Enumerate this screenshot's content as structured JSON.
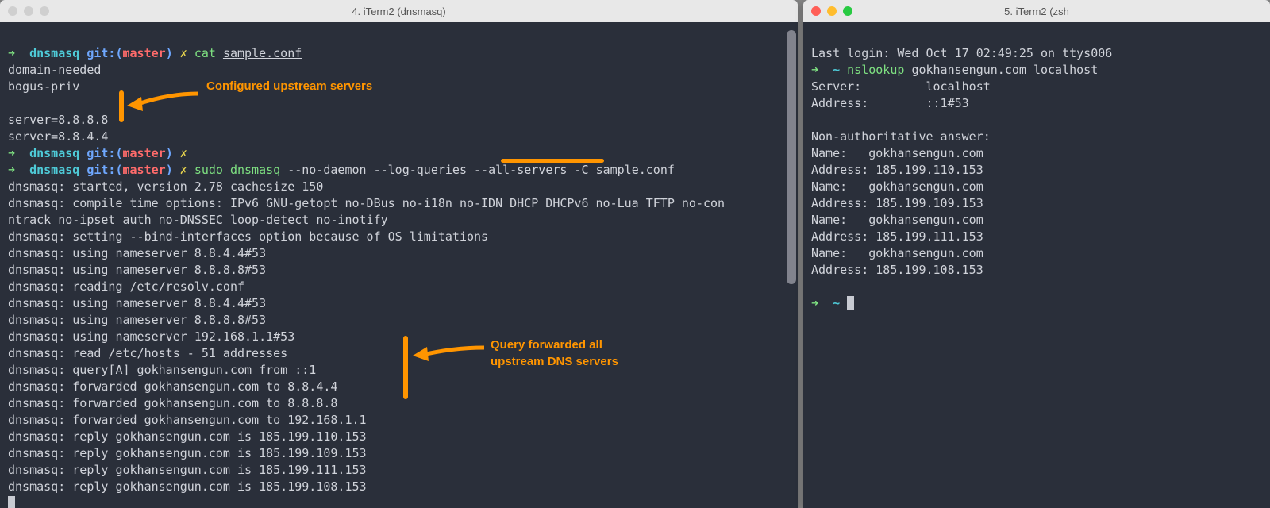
{
  "left": {
    "title": "4. iTerm2 (dnsmasq)",
    "traffic_active": false,
    "prompt": {
      "arrow": "➜",
      "dir": "dnsmasq",
      "git_label": "git:(",
      "branch": "master",
      "git_close": ")",
      "dirty": "✗"
    },
    "cmd1": "cat",
    "cmd1_arg": "sample.conf",
    "conf_lines": [
      "domain-needed",
      "bogus-priv",
      "",
      "server=8.8.8.8",
      "server=8.8.4.4"
    ],
    "cmd2_sudo": "sudo",
    "cmd2_prog": "dnsmasq",
    "cmd2_args_a": "--no-daemon --log-queries",
    "cmd2_flag_hl": "--all-servers",
    "cmd2_args_b": "-C",
    "cmd2_conf": "sample.conf",
    "output": [
      "dnsmasq: started, version 2.78 cachesize 150",
      "dnsmasq: compile time options: IPv6 GNU-getopt no-DBus no-i18n no-IDN DHCP DHCPv6 no-Lua TFTP no-con",
      "ntrack no-ipset auth no-DNSSEC loop-detect no-inotify",
      "dnsmasq: setting --bind-interfaces option because of OS limitations",
      "dnsmasq: using nameserver 8.8.4.4#53",
      "dnsmasq: using nameserver 8.8.8.8#53",
      "dnsmasq: reading /etc/resolv.conf",
      "dnsmasq: using nameserver 8.8.4.4#53",
      "dnsmasq: using nameserver 8.8.8.8#53",
      "dnsmasq: using nameserver 192.168.1.1#53",
      "dnsmasq: read /etc/hosts - 51 addresses",
      "dnsmasq: query[A] gokhansengun.com from ::1",
      "dnsmasq: forwarded gokhansengun.com to 8.8.4.4",
      "dnsmasq: forwarded gokhansengun.com to 8.8.8.8",
      "dnsmasq: forwarded gokhansengun.com to 192.168.1.1",
      "dnsmasq: reply gokhansengun.com is 185.199.110.153",
      "dnsmasq: reply gokhansengun.com is 185.199.109.153",
      "dnsmasq: reply gokhansengun.com is 185.199.111.153",
      "dnsmasq: reply gokhansengun.com is 185.199.108.153"
    ],
    "annotation1": "Configured upstream servers",
    "annotation2_l1": "Query forwarded all",
    "annotation2_l2": "upstream DNS servers"
  },
  "right": {
    "title": "5. iTerm2 (zsh",
    "traffic_active": true,
    "login": "Last login: Wed Oct 17 02:49:25 on ttys006",
    "prompt": {
      "arrow": "➜",
      "dir": "~"
    },
    "cmd": "nslookup",
    "cmd_args": "gokhansengun.com localhost",
    "out": [
      "Server:         localhost",
      "Address:        ::1#53",
      "",
      "Non-authoritative answer:",
      "Name:   gokhansengun.com",
      "Address: 185.199.110.153",
      "Name:   gokhansengun.com",
      "Address: 185.199.109.153",
      "Name:   gokhansengun.com",
      "Address: 185.199.111.153",
      "Name:   gokhansengun.com",
      "Address: 185.199.108.153"
    ]
  }
}
